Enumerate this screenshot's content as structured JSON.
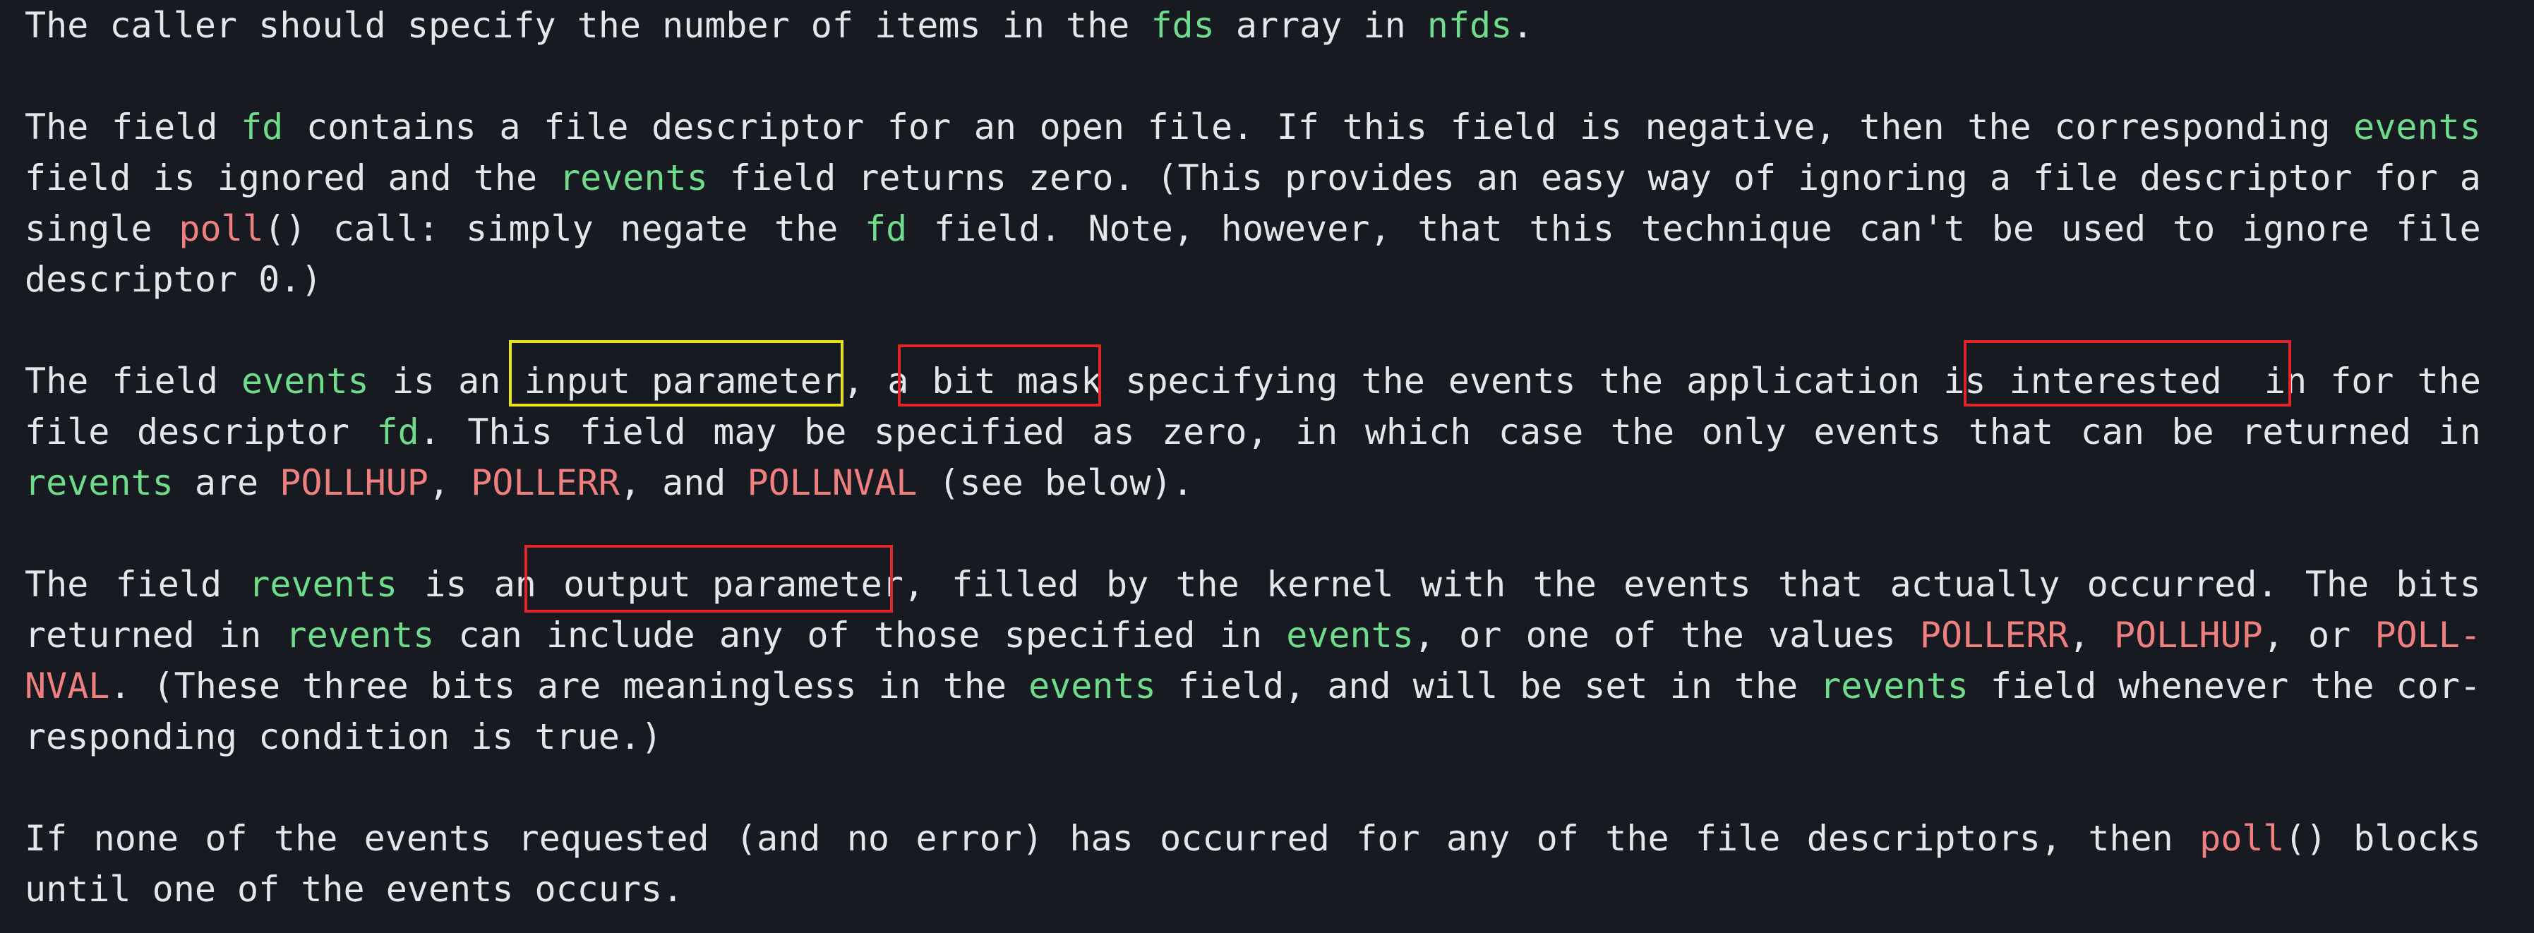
{
  "colors": {
    "background": "#171a21",
    "text": "#e3e6ea",
    "identifier_green": "#6fdc8c",
    "function_red": "#f08080",
    "highlight_yellow": "#e8e21f",
    "highlight_red": "#e0262b"
  },
  "manpage": {
    "l01": {
      "a": "The caller should specify the number of items in the ",
      "b": "fds",
      "c": " array in ",
      "d": "nfds",
      "e": "."
    },
    "l03": {
      "a": "The",
      "b": "field",
      "c": "fd",
      "d": "contains",
      "e": "a",
      "f": "file",
      "g": "descriptor",
      "h": "for",
      "i": "an",
      "j": "open",
      "k": "file.",
      "l": "If",
      "m": "this",
      "n": "field",
      "o": "is",
      "p": "negative,",
      "q": "then",
      "r": "the",
      "s": "corresponding",
      "t": "events"
    },
    "l04": {
      "a": "field",
      "b": "is",
      "c": "ignored",
      "d": "and",
      "e": "the",
      "f": "revents",
      "g": "field",
      "h": "returns",
      "i": "zero.",
      "j": "(This",
      "k": "provides",
      "l": "an",
      "m": "easy",
      "n": "way",
      "o": "of",
      "p": "ignoring",
      "q": "a",
      "r": "file",
      "s": "descriptor",
      "t": "for",
      "u": "a"
    },
    "l05": {
      "a": "single",
      "b1": "poll",
      "b2": "()",
      "c": "call:",
      "d": "simply",
      "e": "negate",
      "f": "the",
      "g": "fd",
      "h": "field.",
      "i": "Note,",
      "j": "however,",
      "k": "that",
      "l": "this",
      "m": "technique",
      "n": "can't",
      "o": "be",
      "p": "used",
      "q": "to",
      "r": "ignore",
      "s": "file"
    },
    "l06": {
      "a": "descriptor 0.)"
    },
    "l08": {
      "a": "The",
      "b": "field",
      "c": "events",
      "d": "is",
      "e": "an",
      "f": "input parameter,",
      "g": "a",
      "h": "bit mask",
      "i": "specifying",
      "j": "the",
      "k": "events",
      "l": "the",
      "m": "application",
      "n": "is",
      "o": "interested  in",
      "p": "for",
      "q": "the"
    },
    "l09": {
      "a": "file",
      "b": "descriptor",
      "c": "fd",
      "c2": ".",
      "d": "This",
      "e": "field",
      "f": "may",
      "g": "be",
      "h": "specified",
      "i": "as",
      "j": "zero,",
      "k": "in",
      "l": "which",
      "m": "case",
      "n": "the",
      "o": "only",
      "p": "events",
      "q": "that",
      "r": "can",
      "s": "be",
      "t": "returned",
      "u": "in"
    },
    "l10": {
      "a": "revents",
      "b": " are ",
      "c": "POLLHUP",
      "d": ", ",
      "e": "POLLERR",
      "f": ", and ",
      "g": "POLLNVAL",
      "h": " (see below)."
    },
    "l12": {
      "a": "The",
      "b": "field",
      "c": "revents",
      "d": "is",
      "e": "an",
      "f": "output parameter,",
      "g": "filled",
      "h": "by",
      "i": "the",
      "j": "kernel",
      "k": "with",
      "l": "the",
      "m": "events",
      "n": "that",
      "o": "actually",
      "p": "occurred.",
      "q": "The",
      "r": "bits"
    },
    "l13": {
      "a": "returned",
      "b": "in",
      "c": "revents",
      "d": "can",
      "e": "include",
      "f": "any",
      "g": "of",
      "h": "those",
      "i": "specified",
      "j": "in",
      "k": "events",
      "k2": ",",
      "l": "or",
      "m": "one",
      "n": "of",
      "o": "the",
      "p": "values",
      "q": "POLLERR",
      "q2": ",",
      "r": "POLLHUP",
      "r2": ",",
      "s": "or",
      "t": "POLL-"
    },
    "l14": {
      "a": "NVAL",
      "a2": ".",
      "b": "(These",
      "c": "three",
      "d": "bits",
      "e": "are",
      "f": "meaningless",
      "g": "in",
      "h": "the",
      "i": "events",
      "j": "field,",
      "k": "and",
      "l": "will",
      "m": "be",
      "n": "set",
      "o": "in",
      "p": "the",
      "q": "revents",
      "r": "field",
      "s": "whenever",
      "t": "the",
      "u": "cor-"
    },
    "l15": {
      "a": "responding condition is true.)"
    },
    "l17": {
      "a": "If",
      "b": "none",
      "c": "of",
      "d": "the",
      "e": "events",
      "f": "requested",
      "g": "(and",
      "h": "no",
      "i": "error)",
      "j": "has",
      "k": "occurred",
      "l": "for",
      "m": "any",
      "n": "of",
      "o": "the",
      "p": "file",
      "q": "descriptors,",
      "r": "then",
      "s1": "poll",
      "s2": "()",
      "t": "blocks"
    },
    "l18": {
      "a": "until one of the events occurs."
    }
  }
}
